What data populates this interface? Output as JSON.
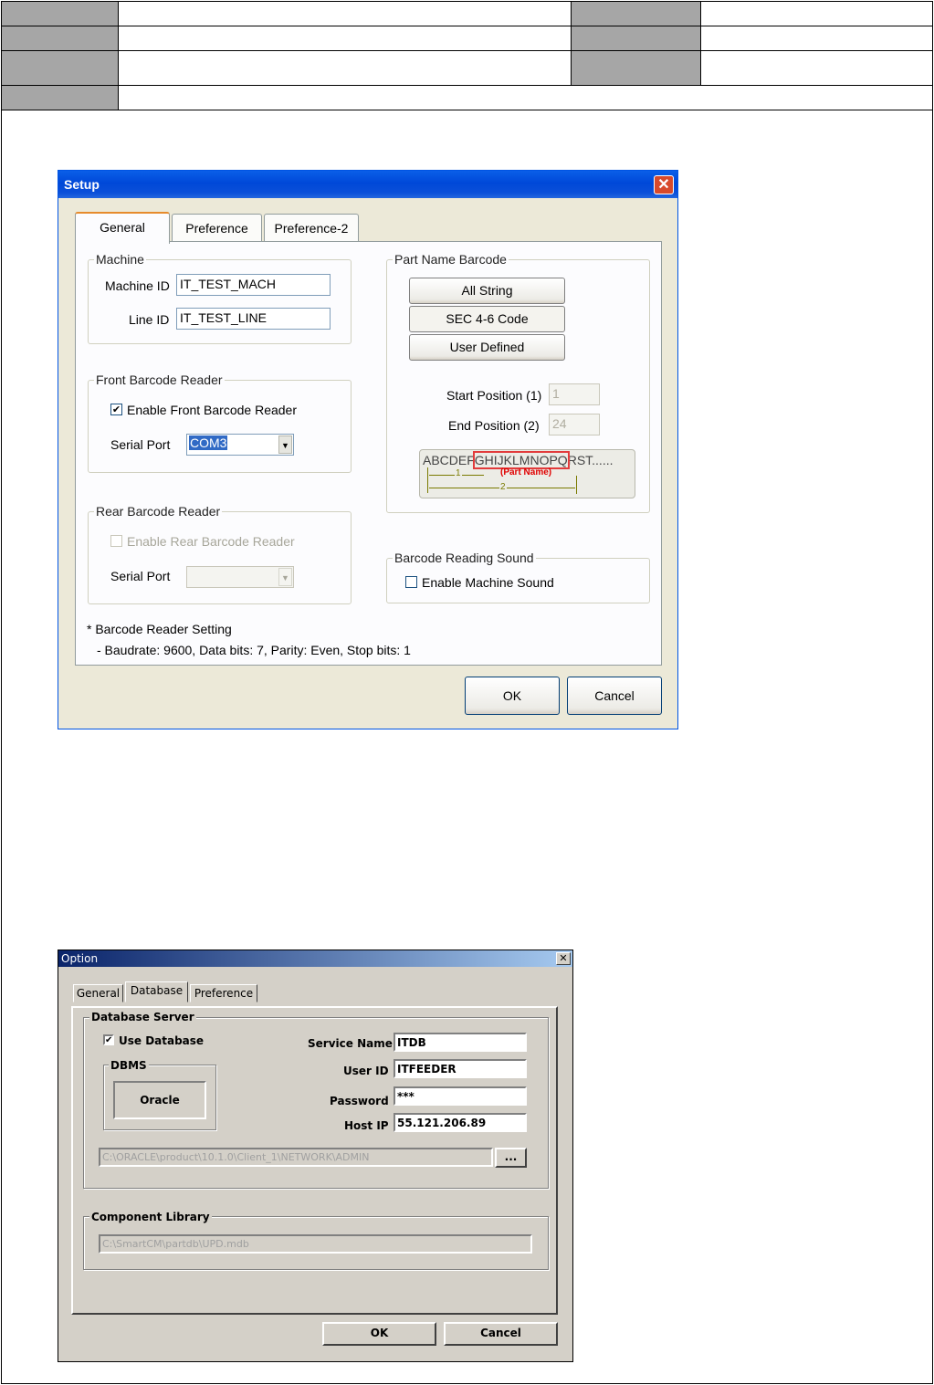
{
  "setup": {
    "title": "Setup",
    "tabs": [
      "General",
      "Preference",
      "Preference-2"
    ],
    "machine": {
      "group": "Machine",
      "machine_id_label": "Machine ID",
      "machine_id_value": "IT_TEST_MACH",
      "line_id_label": "Line ID",
      "line_id_value": "IT_TEST_LINE"
    },
    "front": {
      "group": "Front Barcode Reader",
      "enable_label": "Enable Front Barcode Reader",
      "enable_checked": true,
      "serial_label": "Serial Port",
      "serial_value": "COM3"
    },
    "rear": {
      "group": "Rear Barcode Reader",
      "enable_label": "Enable Rear Barcode Reader",
      "enable_checked": false,
      "serial_label": "Serial Port",
      "serial_value": ""
    },
    "note": {
      "line1": "* Barcode Reader Setting",
      "line2": "- Baudrate: 9600, Data bits: 7, Parity: Even, Stop bits: 1"
    },
    "part_name": {
      "group": "Part Name Barcode",
      "buttons": [
        "All String",
        "SEC 4-6 Code",
        "User Defined"
      ],
      "start_label": "Start Position (1)",
      "start_value": "1",
      "end_label": "End Position (2)",
      "end_value": "24",
      "diagram": {
        "prefix": "ABCDEF",
        "highlight": "GHIJKLMNOPQ",
        "suffix": "RST......",
        "caption": "(Part Name)",
        "marker1": "1",
        "marker2": "2"
      }
    },
    "sound": {
      "group": "Barcode Reading Sound",
      "enable_label": "Enable Machine Sound",
      "enable_checked": false
    },
    "ok": "OK",
    "cancel": "Cancel"
  },
  "option": {
    "title": "Option",
    "tabs": [
      "General",
      "Database",
      "Preference"
    ],
    "db_server": {
      "group": "Database Server",
      "use_db_label": "Use Database",
      "use_db_checked": true,
      "dbms_group": "DBMS",
      "dbms_button": "Oracle",
      "service_name_label": "Service Name",
      "service_name_value": "ITDB",
      "user_id_label": "User ID",
      "user_id_value": "ITFEEDER",
      "password_label": "Password",
      "password_value": "***",
      "host_ip_label": "Host IP",
      "host_ip_value": "55.121.206.89",
      "path_value": "C:\\ORACLE\\product\\10.1.0\\Client_1\\NETWORK\\ADMIN",
      "browse_label": "..."
    },
    "component": {
      "group": "Component Library",
      "path_value": "C:\\SmartCM\\partdb\\UPD.mdb"
    },
    "ok": "OK",
    "cancel": "Cancel"
  }
}
